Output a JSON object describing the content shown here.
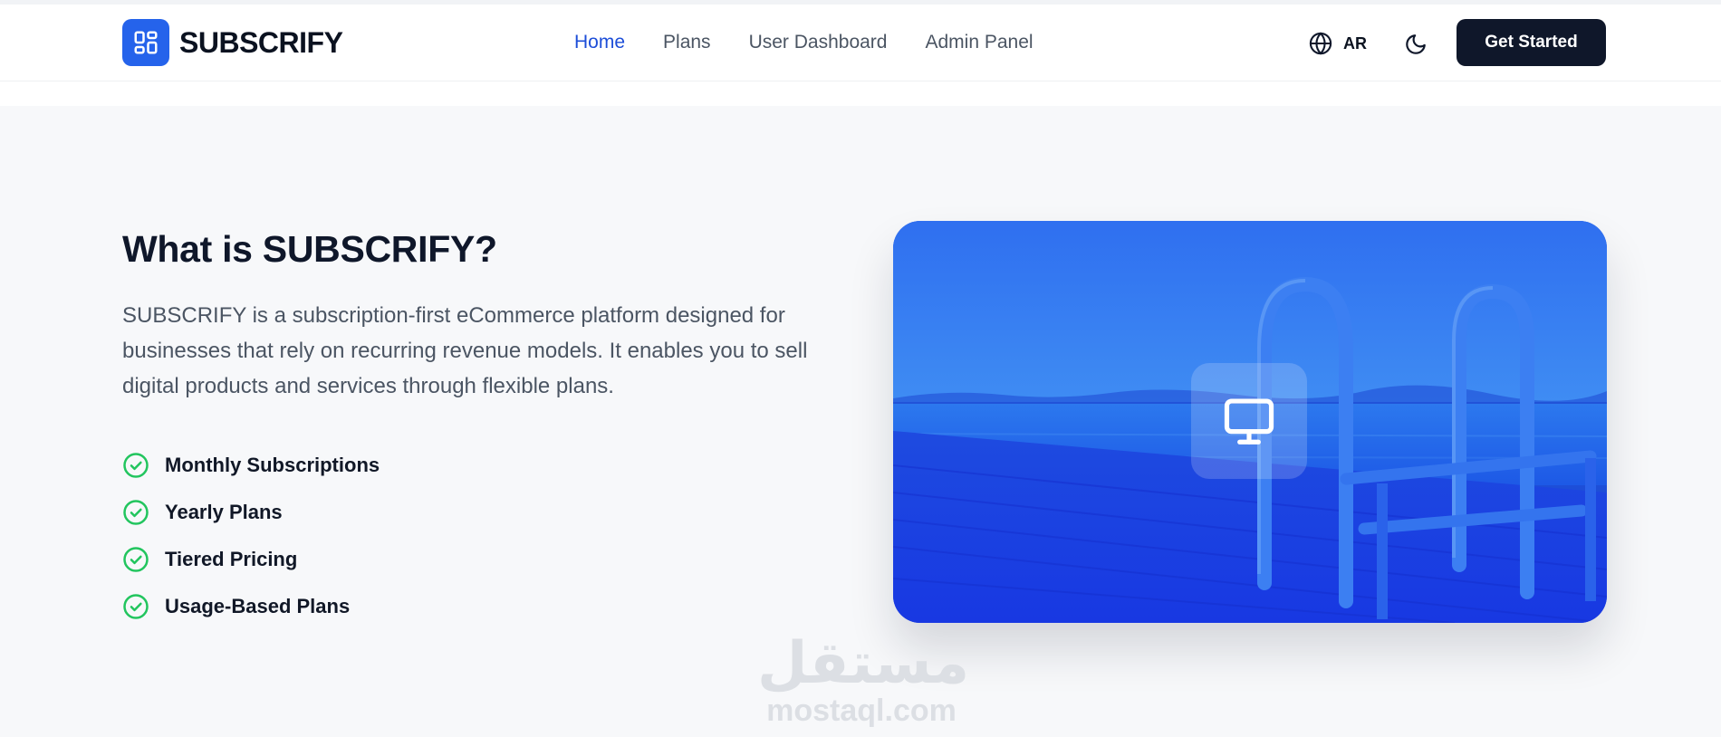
{
  "header": {
    "brand": "SUBSCRIFY",
    "nav": [
      {
        "label": "Home",
        "active": true
      },
      {
        "label": "Plans",
        "active": false
      },
      {
        "label": "User Dashboard",
        "active": false
      },
      {
        "label": "Admin Panel",
        "active": false
      }
    ],
    "language_label": "AR",
    "cta_label": "Get Started"
  },
  "about": {
    "title": "What is SUBSCRIFY?",
    "description": "SUBSCRIFY is a subscription-first eCommerce platform designed for businesses that rely on recurring revenue models. It enables you to sell digital products and services through flexible plans.",
    "features": [
      "Monthly Subscriptions",
      "Yearly Plans",
      "Tiered Pricing",
      "Usage-Based Plans"
    ]
  },
  "watermark": {
    "arabic": "مستقل",
    "latin": "mostaql.com"
  },
  "colors": {
    "brand": "#2563eb",
    "nav_active": "#1d4ed8",
    "cta_bg": "#0f172a",
    "check": "#22c55e"
  },
  "icons": {
    "logo": "dashboard-grid-icon",
    "language": "globe-icon",
    "theme": "moon-icon",
    "feature": "check-circle-icon",
    "hero": "monitor-icon"
  }
}
